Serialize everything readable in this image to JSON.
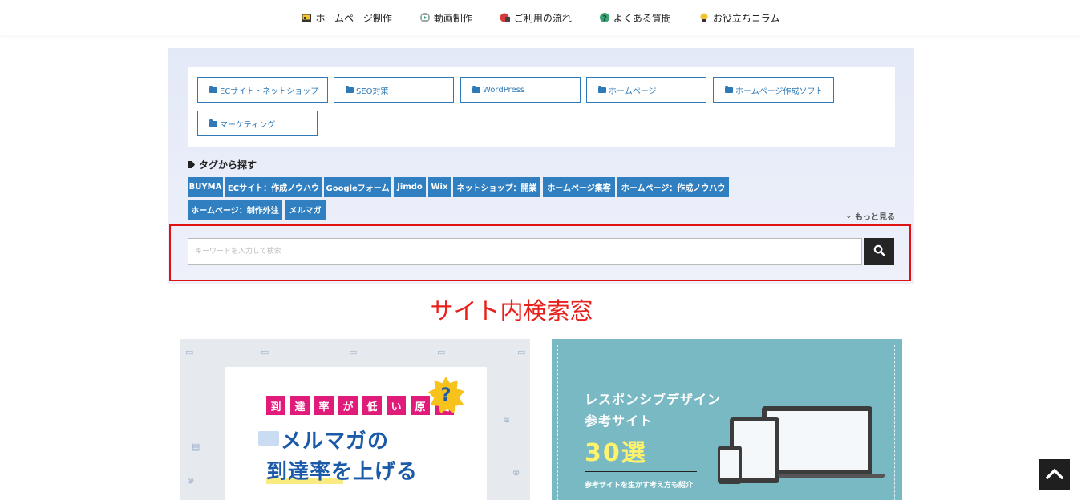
{
  "nav": {
    "items": [
      {
        "label": "ホームページ制作",
        "icon": "homepage-icon"
      },
      {
        "label": "動画制作",
        "icon": "video-icon"
      },
      {
        "label": "ご利用の流れ",
        "icon": "flow-icon"
      },
      {
        "label": "よくある質問",
        "icon": "question-icon"
      },
      {
        "label": "お役立ちコラム",
        "icon": "column-icon"
      }
    ]
  },
  "categories": [
    "ECサイト・ネットショップ",
    "SEO対策",
    "WordPress",
    "ホームページ",
    "ホームページ作成ソフト",
    "マーケティング"
  ],
  "tags": {
    "heading": "タグから探す",
    "items": [
      "BUYMA",
      "ECサイト：作成ノウハウ",
      "Googleフォーム",
      "Jimdo",
      "Wix",
      "ネットショップ：開業",
      "ホームページ集客",
      "ホームページ：作成ノウハウ",
      "ホームページ：制作外注",
      "メルマガ"
    ],
    "more_label": "もっと見る"
  },
  "search": {
    "placeholder": "キーワードを入力して検索"
  },
  "annotation": "サイト内検索窓",
  "thumbnails": {
    "left": {
      "top_chars": [
        "到",
        "達",
        "率",
        "が",
        "低",
        "い",
        "原",
        "因"
      ],
      "question_mark": "?",
      "line1": "メルマガの",
      "line2": "到達率を上げる"
    },
    "right": {
      "title1": "レスポンシブデザイン",
      "title2": "参考サイト",
      "big": "30選",
      "sub": "参考サイトを生かす考え方も紹介"
    }
  },
  "colors": {
    "accent_blue": "#2f7fc1",
    "annotation_red": "#e8201c",
    "highlight_red": "#e01111"
  }
}
